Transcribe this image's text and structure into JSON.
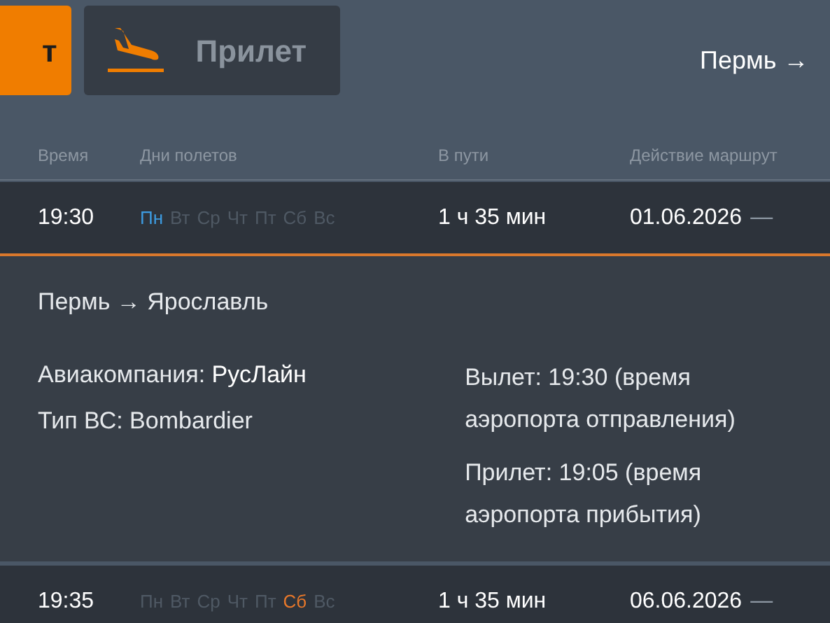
{
  "tabs": [
    {
      "label": "т",
      "selected": true,
      "icon": false
    },
    {
      "label": "Прилет",
      "selected": false,
      "icon": true
    }
  ],
  "route_title": "Пермь →",
  "columns": [
    "Время",
    "Дни полетов",
    "В пути",
    "Действие маршрут"
  ],
  "flights": [
    {
      "time": "19:30",
      "days": [
        {
          "label": "Пн",
          "active": true,
          "color": "#3d9be0"
        },
        {
          "label": "Вт",
          "active": false
        },
        {
          "label": "Ср",
          "active": false
        },
        {
          "label": "Чт",
          "active": false
        },
        {
          "label": "Пт",
          "active": false
        },
        {
          "label": "Сб",
          "active": false
        },
        {
          "label": "Вс",
          "active": false
        }
      ],
      "duration": "1 ч 35 мин",
      "valid_from": "01.06.2026",
      "dash": "—",
      "expanded": true,
      "details": {
        "route": "Пермь → Ярославль",
        "airline_label": "Авиакомпания: ",
        "airline": "РусЛайн",
        "aircraft": "Тип ВС: Bombardier",
        "departure": "Вылет: 19:30 (время аэропорта отправления)",
        "arrival": "Прилет: 19:05 (время аэропорта прибытия)"
      }
    },
    {
      "time": "19:35",
      "days": [
        {
          "label": "Пн",
          "active": false
        },
        {
          "label": "Вт",
          "active": false
        },
        {
          "label": "Ср",
          "active": false
        },
        {
          "label": "Чт",
          "active": false
        },
        {
          "label": "Пт",
          "active": false
        },
        {
          "label": "Сб",
          "active": true,
          "color": "#e8782a"
        },
        {
          "label": "Вс",
          "active": false
        }
      ],
      "duration": "1 ч 35 мин",
      "valid_from": "06.06.2026",
      "dash": "—",
      "expanded": false
    }
  ]
}
